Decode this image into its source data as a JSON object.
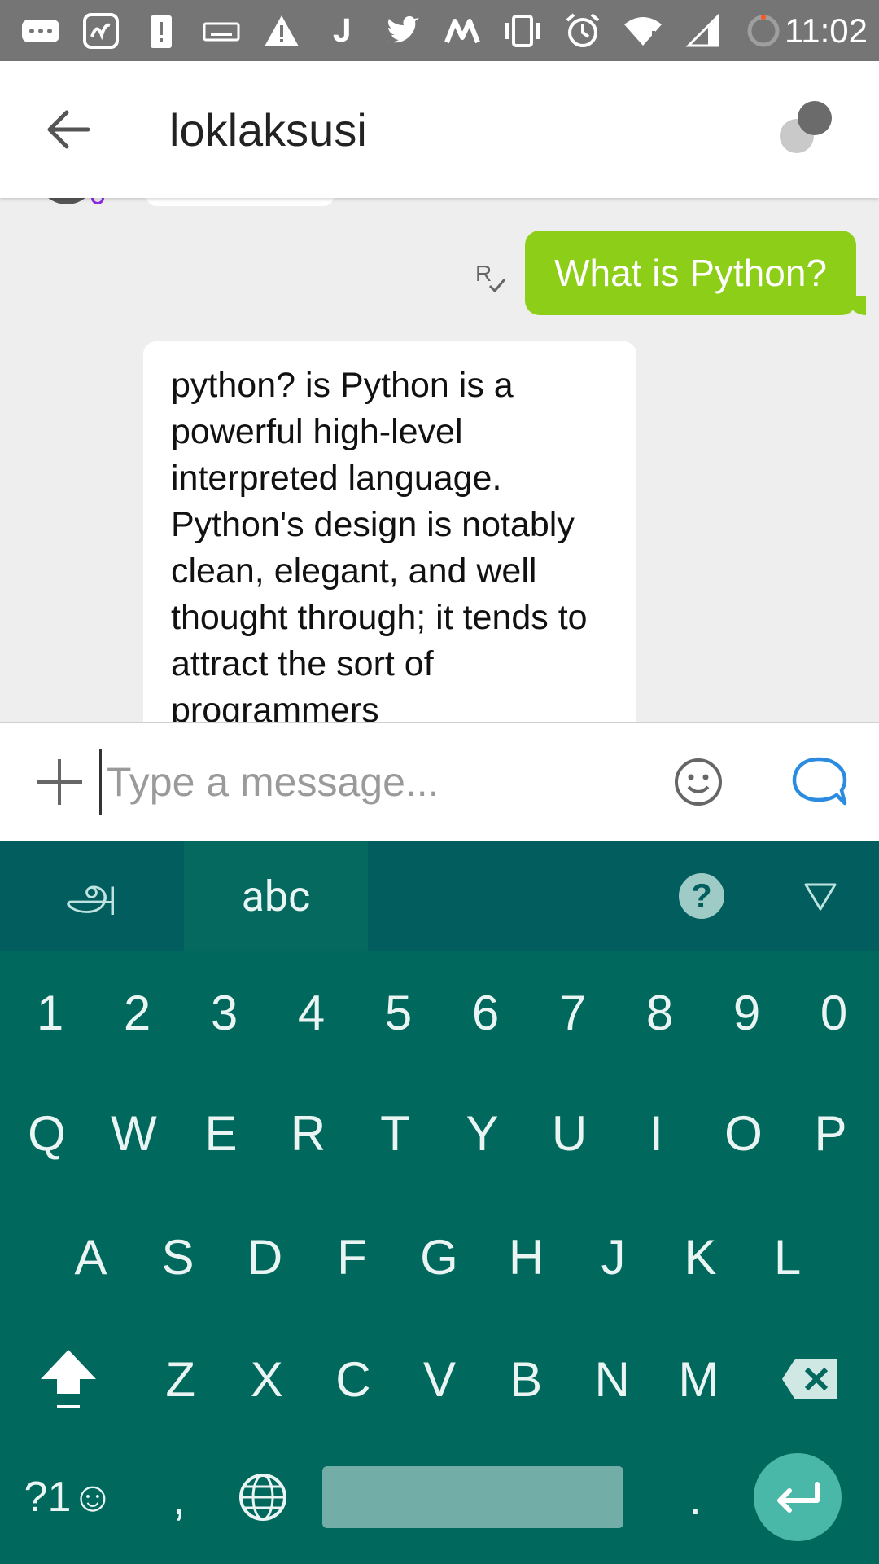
{
  "status_bar": {
    "time": "11:02",
    "icons": [
      "messages-icon",
      "app-icon",
      "alert-icon",
      "keyboard-icon",
      "warning-icon",
      "j-app-icon",
      "twitter-icon",
      "m-app-icon",
      "vibrate-icon",
      "alarm-icon",
      "wifi-icon",
      "signal-icon",
      "battery-icon"
    ]
  },
  "app_bar": {
    "title": "loklaksusi"
  },
  "messages": {
    "read_receipt": "R✓",
    "outgoing": "What is Python?",
    "incoming": "python? is Python is a powerful high-level interpreted language. Python's design is notably clean, elegant, and well thought through; it tends to attract the sort of programmers"
  },
  "input": {
    "placeholder": "Type a message..."
  },
  "keyboard": {
    "languages": [
      "அ",
      "abc"
    ],
    "help": "?",
    "number_row": [
      "1",
      "2",
      "3",
      "4",
      "5",
      "6",
      "7",
      "8",
      "9",
      "0"
    ],
    "row_q": [
      "Q",
      "W",
      "E",
      "R",
      "T",
      "Y",
      "U",
      "I",
      "O",
      "P"
    ],
    "row_a": [
      "A",
      "S",
      "D",
      "F",
      "G",
      "H",
      "J",
      "K",
      "L"
    ],
    "row_z": [
      "Z",
      "X",
      "C",
      "V",
      "B",
      "N",
      "M"
    ],
    "symbols": "?1☺",
    "comma": ",",
    "period": "."
  },
  "colors": {
    "outgoing_bubble": "#8dcf18",
    "keyboard_bg": "#00685c",
    "keyboard_top": "#025e5e",
    "accent_blue": "#2a8be0"
  }
}
